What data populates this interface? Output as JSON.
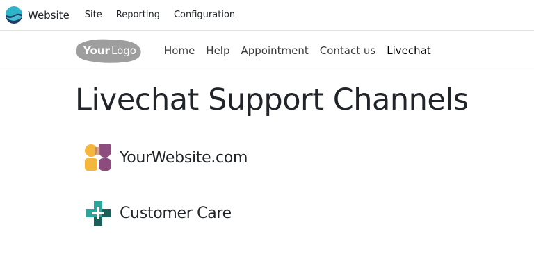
{
  "topbar": {
    "app_name": "Website",
    "menu": [
      {
        "label": "Site"
      },
      {
        "label": "Reporting"
      },
      {
        "label": "Configuration"
      }
    ]
  },
  "site": {
    "logo_text": {
      "your": "Your",
      "logo": "Logo"
    },
    "nav": [
      {
        "label": "Home"
      },
      {
        "label": "Help"
      },
      {
        "label": "Appointment"
      },
      {
        "label": "Contact us"
      },
      {
        "label": "Livechat"
      }
    ]
  },
  "page": {
    "title": "Livechat Support Channels",
    "channels": [
      {
        "name": "YourWebsite.com",
        "icon": "users-icon",
        "colors": [
          "#f5b73b",
          "#8c4d7e"
        ]
      },
      {
        "name": "Customer Care",
        "icon": "medical-cross-icon",
        "colors": [
          "#2ba69a",
          "#1d5e58"
        ]
      }
    ]
  },
  "colors": {
    "app_icon_top": "#2fb5c9",
    "app_icon_bottom": "#1f3d68",
    "logo_bg": "#9e9e9e"
  }
}
